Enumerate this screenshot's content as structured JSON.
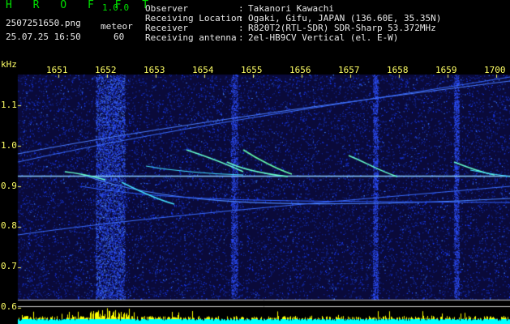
{
  "header": {
    "app_name": "H R O F F T",
    "version": "1.0.0",
    "filename": "2507251650.png",
    "datetime": "25.07.25 16:50",
    "meteor_label": "meteor",
    "meteor_count": "60",
    "info_labels": [
      "Observer",
      "Receiving Location",
      "Receiver",
      "Receiving antenna"
    ],
    "info_sep": ":",
    "info_values": [
      "Takanori Kawachi",
      "Ogaki, Gifu, JAPAN (136.60E, 35.35N)",
      "R820T2(RTL-SDR) SDR-Sharp 53.372MHz",
      "2el-HB9CV Vertical (el. E-W)"
    ]
  },
  "spectrogram": {
    "unit_label": "kHz",
    "time_ticks": [
      "1651",
      "1652",
      "1653",
      "1654",
      "1655",
      "1656",
      "1657",
      "1658",
      "1659",
      "1700"
    ],
    "freq_ticks": [
      "1.1",
      "1.0",
      "0.9",
      "0.8",
      "0.7",
      "0.6"
    ],
    "freq_tick_values": [
      1.1,
      1.0,
      0.9,
      0.8,
      0.7,
      0.6
    ],
    "carrier_khz": 0.925,
    "colors": {
      "background": "#0a0a3a",
      "noise": "#1a3cff",
      "signal": "#66ffcc",
      "carrier": "#88ccff",
      "bar_yellow": "#ffff00",
      "bar_cyan": "#00ffff",
      "tick_yellow": "#ffff66"
    }
  }
}
